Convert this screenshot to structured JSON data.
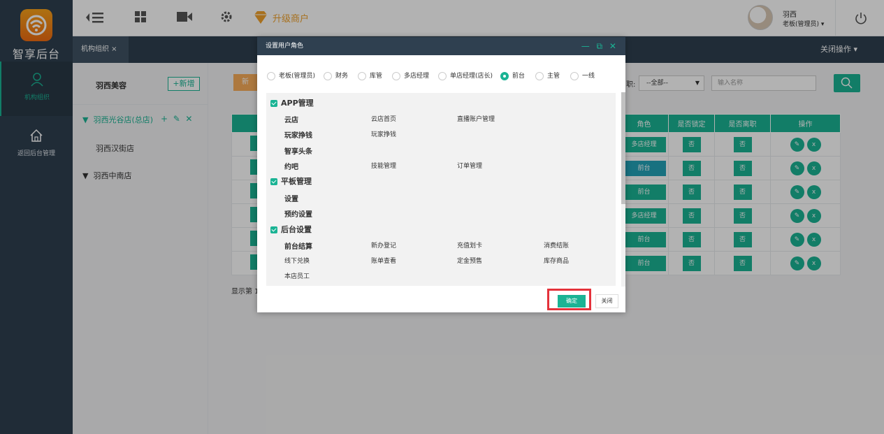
{
  "brand": {
    "name": "智享后台"
  },
  "nav": {
    "items": [
      {
        "label": "机构组织"
      },
      {
        "label": "返回后台管理"
      }
    ]
  },
  "topbar": {
    "upgrade_label": "升级商户",
    "user_name": "羽西",
    "user_role": "老板(管理员)",
    "user_caret": "▾"
  },
  "tabs": {
    "active": "机构组织 ×",
    "close_ops": "关闭操作 ▾"
  },
  "tree": {
    "title": "羽西美容",
    "add_label": "+新增",
    "nodes": [
      "羽西光谷店(总店)",
      "羽西汉街店",
      "羽西中南店"
    ]
  },
  "toolbar": {
    "orange_label": "新",
    "filter_label": "职:",
    "filter_value": "--全部--",
    "search_placeholder": "输入名称"
  },
  "table": {
    "headers": [
      "角色",
      "是否锁定",
      "是否离职",
      "操作"
    ],
    "rows": [
      {
        "role": "多店经理",
        "locked": "否",
        "left": "否"
      },
      {
        "role": "前台",
        "locked": "否",
        "left": "否"
      },
      {
        "role": "前台",
        "locked": "否",
        "left": "否"
      },
      {
        "role": "多店经理",
        "locked": "否",
        "left": "否"
      },
      {
        "role": "前台",
        "locked": "否",
        "left": "否"
      },
      {
        "role": "前台",
        "locked": "否",
        "left": "否"
      }
    ],
    "showing": "显示第 1"
  },
  "modal": {
    "title": "设置用户角色",
    "controls": "— ⧉ ✕",
    "roles": [
      "老板(管理员)",
      "财务",
      "库管",
      "多店经理",
      "单店经理(店长)",
      "前台",
      "主管",
      "一线"
    ],
    "selected_role": "前台",
    "groups": [
      {
        "label": "APP管理"
      },
      {
        "label": "平板管理"
      },
      {
        "label": "后台设置"
      }
    ],
    "items": {
      "yundian": "云店",
      "yundian_home": "云店首页",
      "live_account": "直播账户管理",
      "wanjia": "玩家挣钱",
      "wanjia2": "玩家挣钱",
      "zhixiang": "智享头条",
      "yueba": "约吧",
      "skill": "技能管理",
      "order": "订单管理",
      "settings": "设置",
      "booking": "预约设置",
      "frontdesk": "前台结算",
      "new_reg": "新办登记",
      "recharge": "充值划卡",
      "consume": "消费结账",
      "offline": "线下兑换",
      "bill": "账单查看",
      "deposit": "定金预售",
      "stock": "库存商品",
      "staff": "本店员工"
    },
    "ok_label": "确定",
    "close_label": "关闭"
  },
  "colors": {
    "accent": "#1ab394",
    "nav": "#2f4050",
    "highlight": "#e4323b"
  }
}
